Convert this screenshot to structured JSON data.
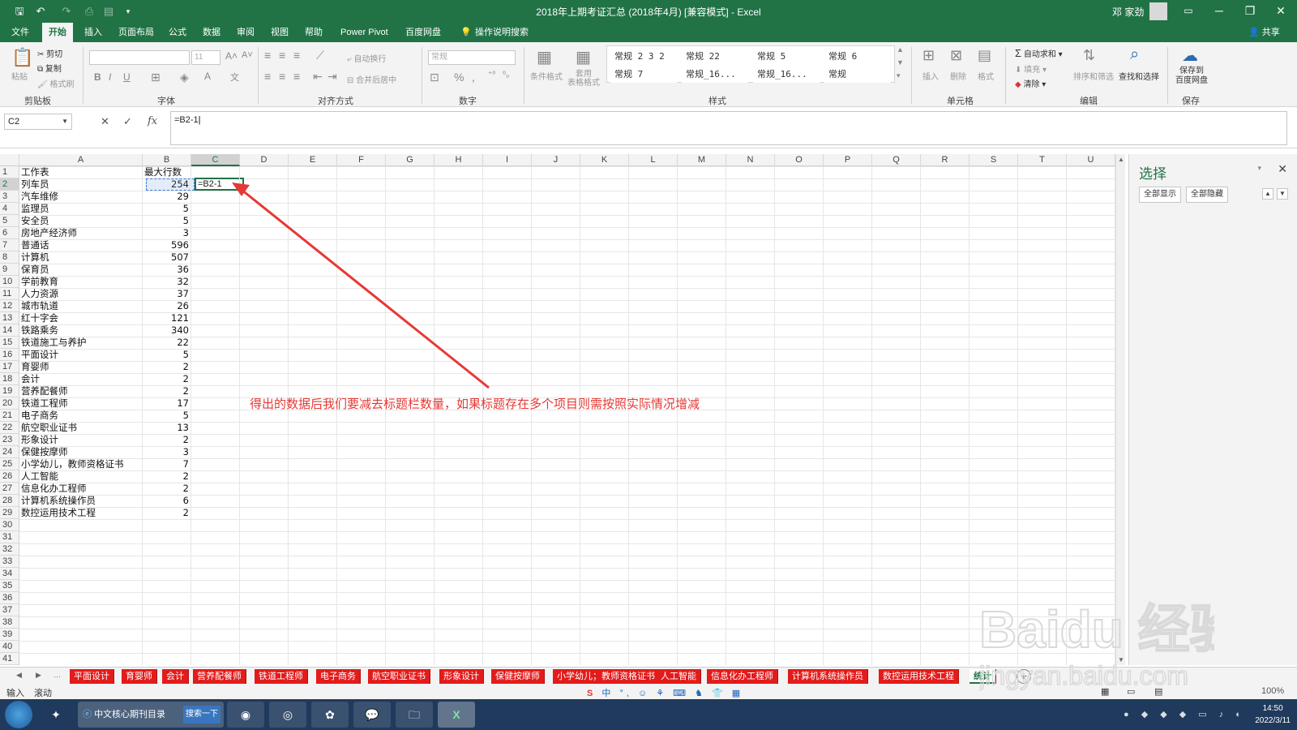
{
  "window": {
    "title": "2018年上期考证汇总 (2018年4月) [兼容模式] - Excel",
    "user_name": "邓 家劲",
    "controls": {
      "minimize": "─",
      "restore": "❐",
      "close": "✕"
    }
  },
  "ribbon_tabs": [
    "文件",
    "开始",
    "插入",
    "页面布局",
    "公式",
    "数据",
    "审阅",
    "视图",
    "帮助",
    "Power Pivot",
    "百度网盘"
  ],
  "active_tab": "开始",
  "tell_me": "操作说明搜索",
  "share_label": "共享",
  "ribbon": {
    "clipboard": {
      "paste": "粘贴",
      "cut": "剪切",
      "copy": "复制",
      "format_painter": "格式刷",
      "group": "剪贴板"
    },
    "font": {
      "size": "11",
      "group": "字体"
    },
    "alignment": {
      "wrap": "自动换行",
      "merge": "合并后居中",
      "group": "对齐方式"
    },
    "number": {
      "format": "常规",
      "group": "数字"
    },
    "styles": {
      "conditional": "条件格式",
      "table": "套用\n表格格式",
      "gallery": [
        "常规 2 3 2",
        "常规 22",
        "常规 5",
        "常规 6",
        "常规 7",
        "常规_16...",
        "常规_16...",
        "常规"
      ],
      "group": "样式"
    },
    "cells": {
      "insert": "插入",
      "delete": "删除",
      "format": "格式",
      "group": "单元格"
    },
    "editing": {
      "autosum": "自动求和",
      "fill": "填充",
      "clear": "清除",
      "sort": "排序和筛选",
      "find": "查找和选择",
      "group": "编辑"
    },
    "save": {
      "button": "保存到\n百度网盘",
      "group": "保存"
    }
  },
  "formula_bar": {
    "name_box": "C2",
    "formula": "=B2-1"
  },
  "columns": [
    "A",
    "B",
    "C",
    "D",
    "E",
    "F",
    "G",
    "H",
    "I",
    "J",
    "K",
    "L",
    "M",
    "N",
    "O",
    "P",
    "Q",
    "R",
    "S",
    "T",
    "U"
  ],
  "rows": [
    [
      "工作表",
      "最大行数"
    ],
    [
      "列车员",
      "254"
    ],
    [
      "汽车维修",
      "29"
    ],
    [
      "监理员",
      "5"
    ],
    [
      "安全员",
      "5"
    ],
    [
      "房地产经济师",
      "3"
    ],
    [
      "普通话",
      "596"
    ],
    [
      "计算机",
      "507"
    ],
    [
      "保育员",
      "36"
    ],
    [
      "学前教育",
      "32"
    ],
    [
      "人力资源",
      "37"
    ],
    [
      "城市轨道",
      "26"
    ],
    [
      "红十字会",
      "121"
    ],
    [
      "铁路乘务",
      "340"
    ],
    [
      "铁道施工与养护",
      "22"
    ],
    [
      "平面设计",
      "5"
    ],
    [
      "育婴师",
      "2"
    ],
    [
      "会计",
      "2"
    ],
    [
      "营养配餐师",
      "2"
    ],
    [
      "铁道工程师",
      "17"
    ],
    [
      "电子商务",
      "5"
    ],
    [
      "航空职业证书",
      "13"
    ],
    [
      "形象设计",
      "2"
    ],
    [
      "保健按摩师",
      "3"
    ],
    [
      "小学幼儿，教师资格证书",
      "7"
    ],
    [
      "人工智能",
      "2"
    ],
    [
      "信息化办工程师",
      "2"
    ],
    [
      "计算机系统操作员",
      "6"
    ],
    [
      "数控运用技术工程",
      "2"
    ]
  ],
  "row_count_visible": 41,
  "active_cell_text": "=B2-1",
  "annotation": "得出的数据后我们要减去标题栏数量，如果标题存在多个项目则需按照实际情况增减",
  "selection_pane": {
    "title": "选择",
    "show_all": "全部显示",
    "hide_all": "全部隐藏"
  },
  "sheet_tabs": [
    "平面设计",
    "育婴师",
    "会计",
    "营养配餐师",
    "铁道工程师",
    "电子商务",
    "航空职业证书",
    "形象设计",
    "保健按摩师",
    "小学幼儿；教师资格证书",
    "人工智能",
    "信息化办工程师",
    "计算机系统操作员",
    "数控运用技术工程",
    "统计"
  ],
  "active_sheet": "统计",
  "statusbar": {
    "mode": "输入",
    "scroll": "滚动",
    "zoom": "100%"
  },
  "taskbar": {
    "ie_label": "中文核心期刊目录",
    "search_label": "搜索一下",
    "time": "14:50",
    "date": "2022/3/11"
  },
  "ime": "中 °, ☺ ⚘ ⌨ ♞ 👕 ▦",
  "watermark": {
    "brand": "Baidu 经验",
    "url": "jingyan.baidu.com"
  },
  "colors": {
    "excel_green": "#217346",
    "sheet_tab_red": "#e31b1b",
    "annotation_red": "#e53935"
  }
}
